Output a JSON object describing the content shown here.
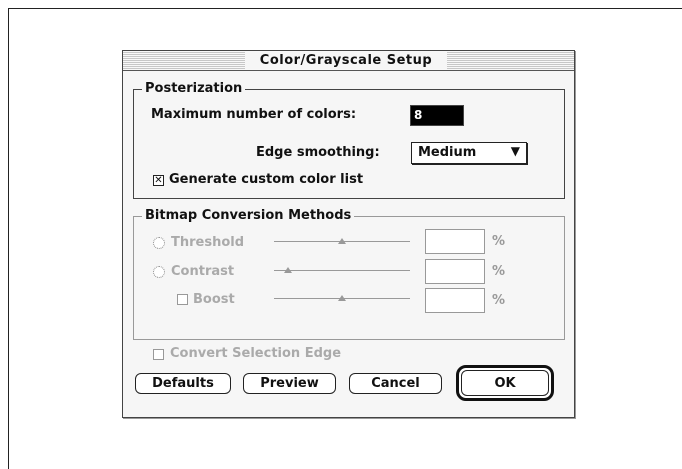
{
  "dialog": {
    "title": "Color/Grayscale Setup",
    "posterization": {
      "group_label": "Posterization",
      "max_colors_label": "Maximum number of colors:",
      "max_colors_value": "8",
      "edge_smoothing_label": "Edge smoothing:",
      "edge_smoothing_value": "Medium",
      "custom_color_list_label": "Generate custom color list",
      "custom_color_list_checked": "✕"
    },
    "bitmap": {
      "group_label": "Bitmap Conversion Methods",
      "threshold_label": "Threshold",
      "contrast_label": "Contrast",
      "boost_label": "Boost",
      "percent_symbol": "%",
      "threshold_level": 0.5,
      "contrast_level": 0.1,
      "boost_level": 0.5
    },
    "convert_selection_edge_label": "Convert Selection Edge",
    "buttons": {
      "defaults": "Defaults",
      "preview": "Preview",
      "cancel": "Cancel",
      "ok": "OK"
    }
  }
}
